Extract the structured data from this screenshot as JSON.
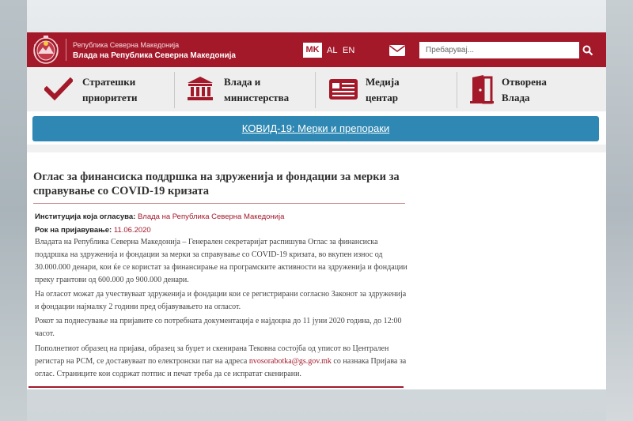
{
  "header": {
    "gov_line1": "Република Северна Македонија",
    "gov_line2": "Влада на Република Северна Македонија",
    "languages": [
      "MK",
      "AL",
      "EN"
    ],
    "search_placeholder": "Пребарувај...",
    "colors": {
      "brand": "#a3192a",
      "banner": "#2e88b3"
    }
  },
  "nav": {
    "items": [
      {
        "line1": "Стратешки",
        "line2": "приоритети",
        "icon": "checkmark-icon"
      },
      {
        "line1": "Влада и",
        "line2": "министерства",
        "icon": "government-building-icon"
      },
      {
        "line1": "Медија",
        "line2": "центар",
        "icon": "newspaper-icon"
      },
      {
        "line1": "Отворена",
        "line2": "Влада",
        "icon": "open-door-icon"
      }
    ]
  },
  "banner": {
    "label": "КОВИД-19: Мерки и препораки"
  },
  "article": {
    "title": "Оглас за финансиска поддршка на здруженија и фондации за мерки за справување со COVID-19 кризата",
    "institution_label": "Институција која огласува:",
    "institution_value": "Влада на Република Северна Македонија",
    "deadline_label": "Рок на пријавување:",
    "deadline_value": "11.06.2020",
    "p1": "Владата на Република Северна Македонија – Генерален секретаријат распишува Оглас за финансиска поддршка на здруженија и фондации за мерки за справување со COVID-19 кризата, во вкупен износ од 30.000.000 денари, кои ќе се користат за финансирање на програмските активности на здруженија и фондации преку грантови од 600.000 до 900.000 денари.",
    "p2": "На огласот можат да учествуваат здруженија и фондации кои се регистрирани согласно Законот за здруженија и фондации најмалку 2 години пред објавувањето на огласот.",
    "p3": "Рокот за поднесување на пријавите со потребната документација е најдоцна до 11 јуни 2020 година, до 12:00 часот.",
    "p4_before": "Пополнетиот образец на пријава, образец за буџет и скенирана Тековна состојба од уписот во Централен регистар на РСМ, се доставуваат по електронски пат на адреса ",
    "p4_email": "nvosorabotka@gs.gov.mk",
    "p4_after": " со назнака Пријава за оглас. Страниците кои содржат потпис и печат треба да се испратат скенирани."
  }
}
